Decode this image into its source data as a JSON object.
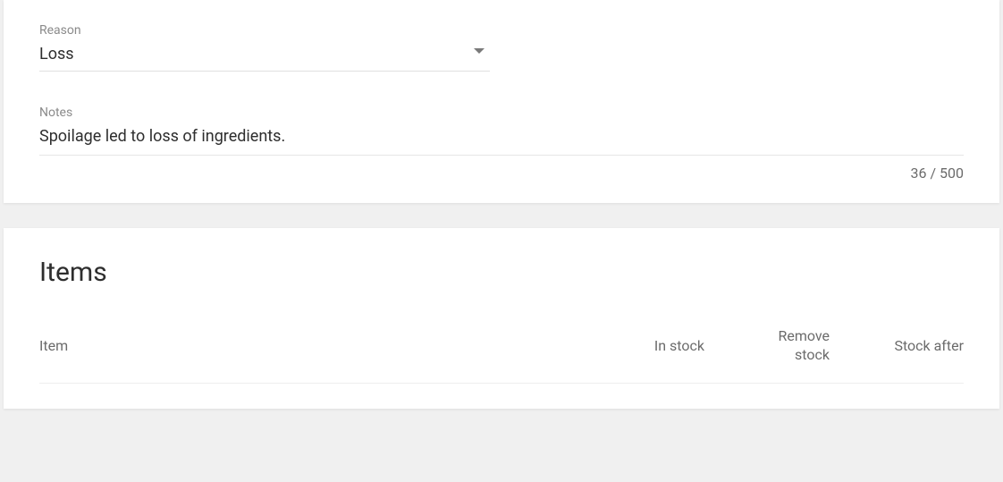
{
  "reason": {
    "label": "Reason",
    "value": "Loss"
  },
  "notes": {
    "label": "Notes",
    "value": "Spoilage led to loss of ingredients.",
    "counter": "36 / 500"
  },
  "items": {
    "title": "Items",
    "columns": {
      "item": "Item",
      "in_stock": "In stock",
      "remove_stock_line1": "Remove",
      "remove_stock_line2": "stock",
      "stock_after": "Stock after"
    }
  }
}
